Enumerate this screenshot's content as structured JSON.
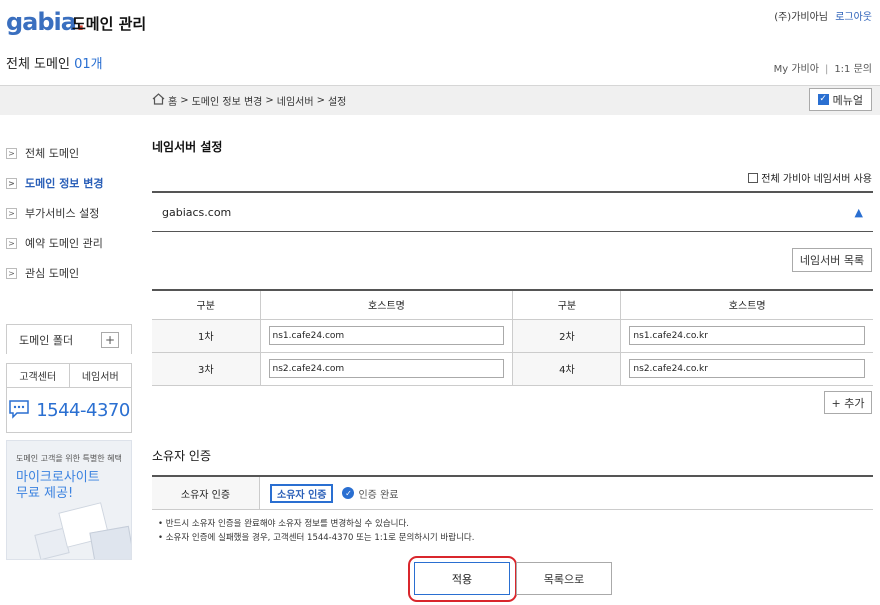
{
  "header": {
    "logo": "gabia",
    "app_title": "도메인 관리",
    "company": "(주)가비아님",
    "logout": "로그아웃",
    "total_label": "전체 도메인",
    "total_count": "01개",
    "my_gabia": "My 가비아",
    "inquiry": "1:1 문의"
  },
  "breadcrumb": [
    "홈",
    "도메인 정보 변경",
    "네임서버",
    "설정"
  ],
  "manual_label": "메뉴얼",
  "sidebar": {
    "items": [
      {
        "label": "전체 도메인",
        "active": false
      },
      {
        "label": "도메인 정보 변경",
        "active": true
      },
      {
        "label": "부가서비스 설정",
        "active": false
      },
      {
        "label": "예약 도메인 관리",
        "active": false
      },
      {
        "label": "관심 도메인",
        "active": false
      }
    ],
    "folder_label": "도메인 폴더",
    "cs_tabs": [
      "고객센터",
      "네임서버"
    ],
    "phone": "1544-4370",
    "banner_small": "도메인 고객을 위한 특별한 혜택",
    "banner_line1": "마이크로사이트",
    "banner_line2": "무료 제공!"
  },
  "nameserver": {
    "title": "네임서버 설정",
    "all_gabia_label": "전체 가비아 네임서버 사용",
    "domain": "gabiacs.com",
    "list_button": "네임서버 목록",
    "headers": [
      "구분",
      "호스트명",
      "구분",
      "호스트명"
    ],
    "rows": [
      [
        {
          "label": "1차",
          "value": "ns1.cafe24.com"
        },
        {
          "label": "2차",
          "value": "ns1.cafe24.co.kr"
        }
      ],
      [
        {
          "label": "3차",
          "value": "ns2.cafe24.com"
        },
        {
          "label": "4차",
          "value": "ns2.cafe24.co.kr"
        }
      ]
    ],
    "add_button": "+ 추가"
  },
  "owner": {
    "title": "소유자 인증",
    "row_label": "소유자 인증",
    "button": "소유자 인증",
    "status": "인증 완료",
    "notes": [
      "반드시 소유자 인증을 완료해야 소유자 정보를 변경하실 수 있습니다.",
      "소유자 인증에 실패했을 경우, 고객센터 1544-4370 또는 1:1로 문의하시기 바랍니다."
    ]
  },
  "actions": {
    "apply": "적용",
    "list": "목록으로"
  },
  "colors": {
    "accent": "#2a6fd1",
    "highlight_ring": "#d9262c"
  }
}
